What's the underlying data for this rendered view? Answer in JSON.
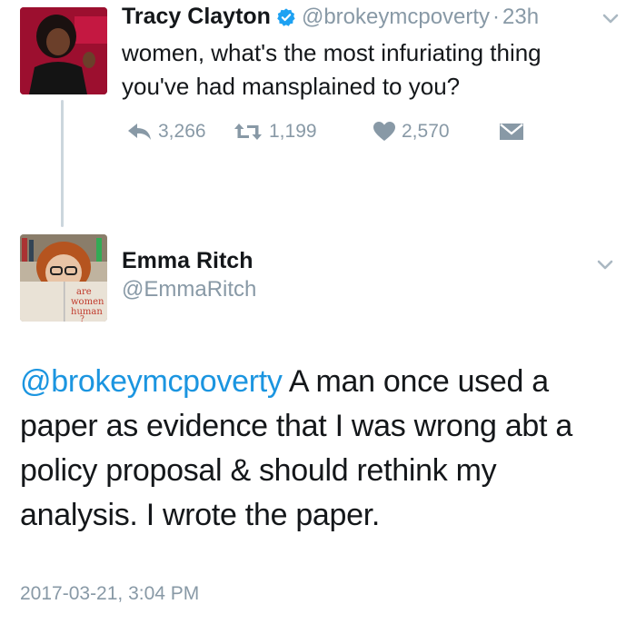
{
  "tweet": {
    "author_name": "Tracy Clayton",
    "author_handle": "@brokeymcpoverty",
    "separator": "·",
    "age": "23h",
    "text": "women, what's the most infuriating thing you've had mansplained to you?",
    "actions": {
      "reply_count": "3,266",
      "retweet_count": "1,199",
      "like_count": "2,570"
    }
  },
  "reply": {
    "author_name": "Emma Ritch",
    "author_handle": "@EmmaRitch",
    "mention": "@brokeymcpoverty",
    "text": " A man once used a paper as evidence that I was wrong abt a policy proposal & should rethink my analysis. I wrote the paper.",
    "timestamp": "2017-03-21, 3:04 PM",
    "avatar_book_text": [
      "are",
      "women",
      "human",
      "?"
    ]
  },
  "colors": {
    "text": "#14171a",
    "secondary": "#8899a6",
    "link": "#1b95e0",
    "verified": "#1da1f2",
    "thread_line": "#ccd6dd"
  },
  "icons": {
    "verified": "verified-badge-icon",
    "reply": "reply-icon",
    "retweet": "retweet-icon",
    "like": "heart-icon",
    "dm": "direct-message-icon",
    "menu": "chevron-down-icon"
  }
}
